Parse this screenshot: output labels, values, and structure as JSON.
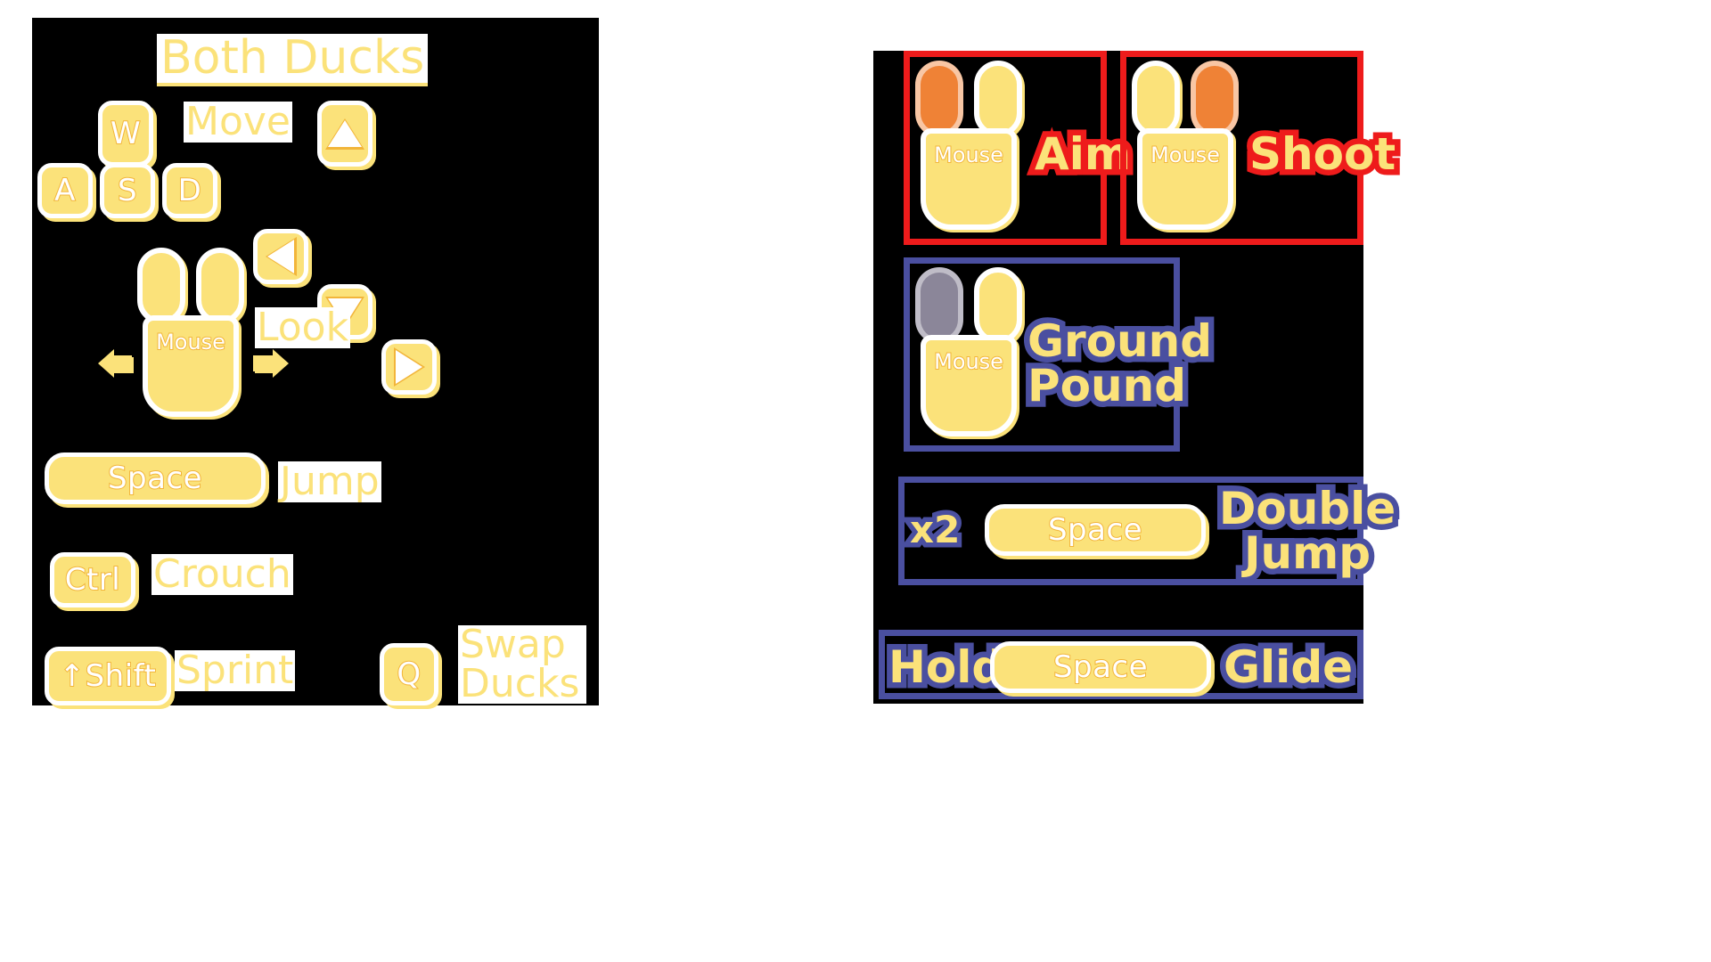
{
  "left_panel": {
    "title": "Both Ducks",
    "rows": [
      {
        "id": "move",
        "label": "Move",
        "wasd": [
          "W",
          "A",
          "S",
          "D"
        ],
        "arrows": [
          "arrow-up",
          "arrow-left",
          "arrow-down",
          "arrow-right"
        ]
      },
      {
        "id": "look",
        "label": "Look",
        "input": "Mouse"
      },
      {
        "id": "jump",
        "label": "Jump",
        "key": "Space"
      },
      {
        "id": "crouch",
        "label": "Crouch",
        "key": "Ctrl"
      },
      {
        "id": "sprint",
        "label": "Sprint",
        "key": "↑Shift"
      },
      {
        "id": "swap",
        "label": "Swap Ducks",
        "label_line1": "Swap",
        "label_line2": "Ducks",
        "key": "Q"
      }
    ],
    "mouse_label": "Mouse"
  },
  "right_panel": {
    "abilities": [
      {
        "id": "aim",
        "label": "Aim",
        "accent": "#ee1b1b",
        "input": "Mouse",
        "mouse_label": "Mouse",
        "highlight_button": "left",
        "highlight_color": "#ef8236"
      },
      {
        "id": "shoot",
        "label": "Shoot",
        "accent": "#ee1b1b",
        "input": "Mouse",
        "mouse_label": "Mouse",
        "highlight_button": "right",
        "highlight_color": "#ef8236"
      },
      {
        "id": "ground-pound",
        "label": "Ground Pound",
        "label_line1": "Ground",
        "label_line2": "Pound",
        "accent": "#4a4fa0",
        "input": "Mouse",
        "mouse_label": "Mouse",
        "highlight_button": "left",
        "highlight_color": "#8b8699"
      },
      {
        "id": "double-jump",
        "label": "Double Jump",
        "label_line1": "Double",
        "label_line2": "Jump",
        "accent": "#4a4fa0",
        "prefix": "x2",
        "key": "Space"
      },
      {
        "id": "glide",
        "label": "Glide",
        "accent": "#4a4fa0",
        "prefix": "Hold",
        "key": "Space"
      }
    ]
  },
  "theme": {
    "key_fill": "#fbe27a",
    "key_stroke": "#f2b53a",
    "key_border": "#ffffff",
    "panel_bg": "#000000",
    "text_yellow": "#fbe27a",
    "accent_red": "#ee1b1b",
    "accent_blue": "#4a4fa0",
    "accent_orange": "#ef8236",
    "accent_gray": "#8b8699"
  }
}
